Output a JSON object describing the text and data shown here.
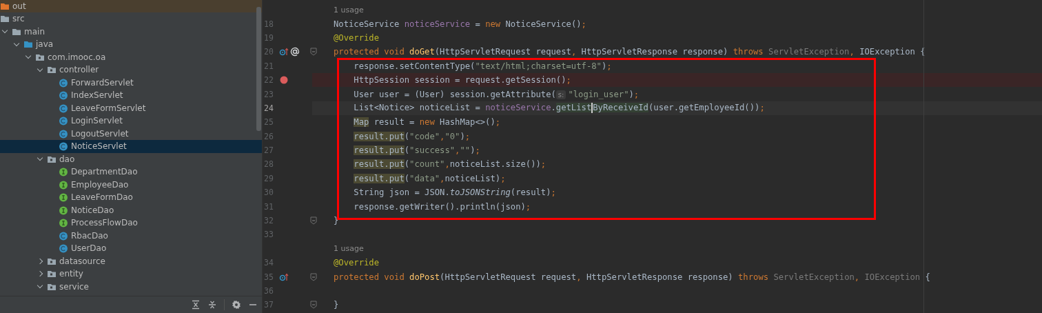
{
  "project_tree": {
    "items": [
      {
        "label": "out",
        "kind": "excluded_folder"
      },
      {
        "label": "src",
        "kind": "folder",
        "children": [
          {
            "label": "main",
            "kind": "folder",
            "expanded": true,
            "children": [
              {
                "label": "java",
                "kind": "source_folder",
                "expanded": true,
                "children": [
                  {
                    "label": "com.imooc.oa",
                    "kind": "package",
                    "expanded": true,
                    "children": [
                      {
                        "label": "controller",
                        "kind": "package",
                        "expanded": true,
                        "children": [
                          {
                            "label": "ForwardServlet",
                            "kind": "class",
                            "selected": false
                          },
                          {
                            "label": "IndexServlet",
                            "kind": "class",
                            "selected": false
                          },
                          {
                            "label": "LeaveFormServlet",
                            "kind": "class",
                            "selected": false
                          },
                          {
                            "label": "LoginServlet",
                            "kind": "class",
                            "selected": false
                          },
                          {
                            "label": "LogoutServlet",
                            "kind": "class",
                            "selected": false
                          },
                          {
                            "label": "NoticeServlet",
                            "kind": "class",
                            "selected": true
                          }
                        ]
                      },
                      {
                        "label": "dao",
                        "kind": "package",
                        "expanded": true,
                        "children": [
                          {
                            "label": "DepartmentDao",
                            "kind": "interface",
                            "selected": false
                          },
                          {
                            "label": "EmployeeDao",
                            "kind": "interface",
                            "selected": false
                          },
                          {
                            "label": "LeaveFormDao",
                            "kind": "interface",
                            "selected": false
                          },
                          {
                            "label": "NoticeDao",
                            "kind": "interface",
                            "selected": false
                          },
                          {
                            "label": "ProcessFlowDao",
                            "kind": "interface",
                            "selected": false
                          },
                          {
                            "label": "RbacDao",
                            "kind": "class",
                            "selected": false
                          },
                          {
                            "label": "UserDao",
                            "kind": "class",
                            "selected": false
                          }
                        ]
                      },
                      {
                        "label": "datasource",
                        "kind": "package",
                        "expanded": false
                      },
                      {
                        "label": "entity",
                        "kind": "package",
                        "expanded": false
                      },
                      {
                        "label": "service",
                        "kind": "package",
                        "expanded": true
                      }
                    ]
                  }
                ]
              }
            ]
          }
        ]
      }
    ]
  },
  "editor": {
    "lines": [
      {
        "kind": "hint",
        "text": "1 usage"
      },
      {
        "kind": "code",
        "number": "18",
        "tokens": [
          {
            "kind": "plain",
            "text": "NoticeService "
          },
          {
            "kind": "field",
            "text": "noticeService"
          },
          {
            "kind": "plain",
            "text": " = "
          },
          {
            "kind": "kw",
            "text": "new"
          },
          {
            "kind": "plain",
            "text": " NoticeService()"
          },
          {
            "kind": "punct",
            "text": ";"
          }
        ]
      },
      {
        "kind": "code",
        "number": "19",
        "tokens": [
          {
            "kind": "annot",
            "text": "@Override"
          }
        ]
      },
      {
        "kind": "code",
        "number": "20",
        "gutter_icons": [
          {
            "kind": "override"
          },
          {
            "kind": "at"
          }
        ],
        "fold": true,
        "tokens": [
          {
            "kind": "kw",
            "text": "protected void "
          },
          {
            "kind": "fn",
            "text": "doGet"
          },
          {
            "kind": "plain",
            "text": "(HttpServletRequest request"
          },
          {
            "kind": "punct",
            "text": ", "
          },
          {
            "kind": "plain",
            "text": "HttpServletResponse response) "
          },
          {
            "kind": "kw",
            "text": "throws "
          },
          {
            "kind": "dim",
            "text": "ServletException"
          },
          {
            "kind": "punct",
            "text": ", "
          },
          {
            "kind": "plain",
            "text": "IOException {"
          }
        ]
      },
      {
        "kind": "boxed_block",
        "lines": [
          {
            "kind": "code",
            "number": "21",
            "tokens": [
              {
                "kind": "plain",
                "text": "response.setContentType("
              },
              {
                "kind": "str",
                "text": "\"text/html;charset=utf-8\""
              },
              {
                "kind": "plain",
                "text": ")"
              },
              {
                "kind": "punct",
                "text": ";"
              }
            ]
          },
          {
            "kind": "code",
            "number": "22",
            "breakpoint": true,
            "tokens": [
              {
                "kind": "plain",
                "text": "HttpSession session = request.getSession()"
              },
              {
                "kind": "punct",
                "text": ";"
              }
            ]
          },
          {
            "kind": "code",
            "number": "23",
            "tokens": [
              {
                "kind": "plain",
                "text": "User user = (User) session.getAttribute("
              },
              {
                "kind": "hint",
                "text": "s:"
              },
              {
                "kind": "str",
                "text": "\"login_user\""
              },
              {
                "kind": "plain",
                "text": ")"
              },
              {
                "kind": "punct",
                "text": ";"
              }
            ]
          },
          {
            "kind": "code",
            "number": "24",
            "current": true,
            "tokens": [
              {
                "kind": "plain",
                "text": "List<Notice> noticeList = "
              },
              {
                "kind": "field",
                "text": "noticeService"
              },
              {
                "kind": "plain",
                "text": "."
              },
              {
                "kind": "match",
                "text": "getList",
                "caret_after": true
              },
              {
                "kind": "match",
                "text": "ByReceiveId"
              },
              {
                "kind": "plain",
                "text": "(user.getEmployeeId())"
              },
              {
                "kind": "punct",
                "text": ";"
              }
            ]
          },
          {
            "kind": "code",
            "number": "25",
            "tokens": [
              {
                "kind": "hl",
                "text": "Map"
              },
              {
                "kind": "plain",
                "text": " result = "
              },
              {
                "kind": "kw",
                "text": "new"
              },
              {
                "kind": "plain",
                "text": " HashMap<>()"
              },
              {
                "kind": "punct",
                "text": ";"
              }
            ]
          },
          {
            "kind": "code",
            "number": "26",
            "tokens": [
              {
                "kind": "hl",
                "text": "result.put"
              },
              {
                "kind": "plain",
                "text": "("
              },
              {
                "kind": "str",
                "text": "\"code\""
              },
              {
                "kind": "punct",
                "text": ","
              },
              {
                "kind": "str",
                "text": "\"0\""
              },
              {
                "kind": "plain",
                "text": ")"
              },
              {
                "kind": "punct",
                "text": ";"
              }
            ]
          },
          {
            "kind": "code",
            "number": "27",
            "tokens": [
              {
                "kind": "hl",
                "text": "result.put"
              },
              {
                "kind": "plain",
                "text": "("
              },
              {
                "kind": "str",
                "text": "\"success\""
              },
              {
                "kind": "punct",
                "text": ","
              },
              {
                "kind": "str",
                "text": "\"\""
              },
              {
                "kind": "plain",
                "text": ")"
              },
              {
                "kind": "punct",
                "text": ";"
              }
            ]
          },
          {
            "kind": "code",
            "number": "28",
            "tokens": [
              {
                "kind": "hl",
                "text": "result.put"
              },
              {
                "kind": "plain",
                "text": "("
              },
              {
                "kind": "str",
                "text": "\"count\""
              },
              {
                "kind": "punct",
                "text": ","
              },
              {
                "kind": "plain",
                "text": "noticeList.size())"
              },
              {
                "kind": "punct",
                "text": ";"
              }
            ]
          },
          {
            "kind": "code",
            "number": "29",
            "tokens": [
              {
                "kind": "hl",
                "text": "result.put"
              },
              {
                "kind": "plain",
                "text": "("
              },
              {
                "kind": "str",
                "text": "\"data\""
              },
              {
                "kind": "punct",
                "text": ","
              },
              {
                "kind": "plain",
                "text": "noticeList)"
              },
              {
                "kind": "punct",
                "text": ";"
              }
            ]
          },
          {
            "kind": "code",
            "number": "30",
            "tokens": [
              {
                "kind": "plain",
                "text": "String json = JSON."
              },
              {
                "kind": "static",
                "text": "toJSONString"
              },
              {
                "kind": "plain",
                "text": "(result)"
              },
              {
                "kind": "punct",
                "text": ";"
              }
            ]
          },
          {
            "kind": "code",
            "number": "31",
            "tokens": [
              {
                "kind": "plain",
                "text": "response.getWriter().println(json)"
              },
              {
                "kind": "punct",
                "text": ";"
              }
            ]
          }
        ]
      },
      {
        "kind": "code",
        "number": "32",
        "fold": true,
        "tokens": [
          {
            "kind": "plain",
            "text": "}"
          }
        ]
      },
      {
        "kind": "code",
        "number": "33"
      },
      {
        "kind": "hint",
        "text": "1 usage"
      },
      {
        "kind": "code",
        "number": "34",
        "tokens": [
          {
            "kind": "annot",
            "text": "@Override"
          }
        ]
      },
      {
        "kind": "code",
        "number": "35",
        "gutter_icons": [
          {
            "kind": "override"
          }
        ],
        "fold": true,
        "tokens": [
          {
            "kind": "kw",
            "text": "protected void "
          },
          {
            "kind": "fn",
            "text": "doPost"
          },
          {
            "kind": "plain",
            "text": "(HttpServletRequest request"
          },
          {
            "kind": "punct",
            "text": ", "
          },
          {
            "kind": "plain",
            "text": "HttpServletResponse response) "
          },
          {
            "kind": "kw",
            "text": "throws "
          },
          {
            "kind": "dim",
            "text": "ServletException"
          },
          {
            "kind": "punct",
            "text": ", "
          },
          {
            "kind": "dim",
            "text": "IOException"
          },
          {
            "kind": "plain",
            "text": " {"
          }
        ]
      },
      {
        "kind": "code",
        "number": "36"
      },
      {
        "kind": "code",
        "number": "37",
        "fold": true,
        "tokens": [
          {
            "kind": "plain",
            "text": "}"
          }
        ]
      }
    ]
  }
}
